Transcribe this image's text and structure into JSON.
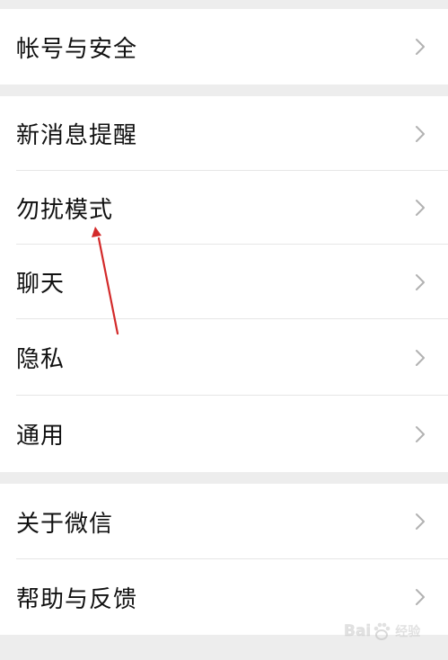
{
  "settings": {
    "groups": [
      {
        "items": [
          {
            "label": "帐号与安全"
          }
        ]
      },
      {
        "items": [
          {
            "label": "新消息提醒"
          },
          {
            "label": "勿扰模式"
          },
          {
            "label": "聊天"
          },
          {
            "label": "隐私"
          },
          {
            "label": "通用"
          }
        ]
      },
      {
        "items": [
          {
            "label": "关于微信"
          },
          {
            "label": "帮助与反馈"
          }
        ]
      }
    ]
  },
  "icons": {
    "row_chevron": "chevron-right-icon",
    "annotation": "red-arrow-annotation",
    "watermark_paw": "baidu-paw-icon"
  },
  "colors": {
    "background": "#ededed",
    "row_background": "#ffffff",
    "text": "#111111",
    "chevron": "#b2b2b2",
    "divider": "#e6e6e6",
    "annotation_arrow": "#d32a2a"
  },
  "watermark": {
    "brand_left": "Bai",
    "brand_right": "经验"
  }
}
